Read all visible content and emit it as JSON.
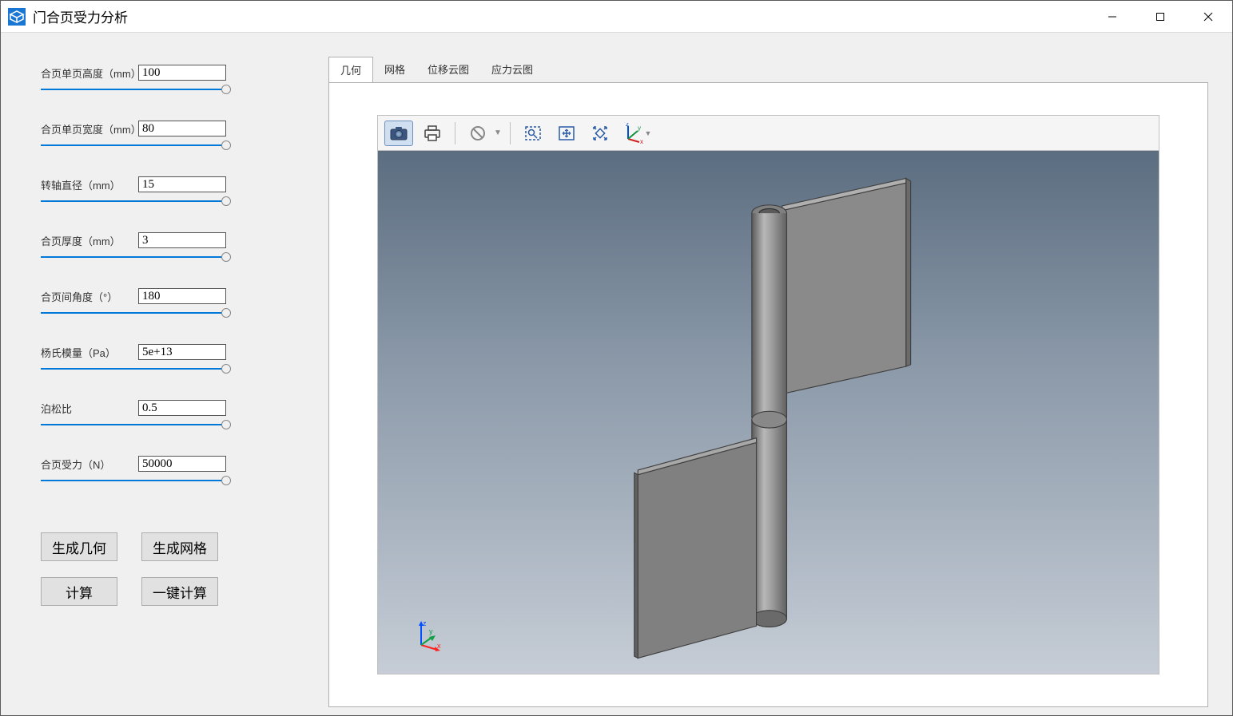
{
  "window": {
    "title": "门合页受力分析"
  },
  "params": [
    {
      "label": "合页单页高度（mm）",
      "value": "100"
    },
    {
      "label": "合页单页宽度（mm）",
      "value": "80"
    },
    {
      "label": "转轴直径（mm）",
      "value": "15"
    },
    {
      "label": "合页厚度（mm）",
      "value": "3"
    },
    {
      "label": "合页间角度（°）",
      "value": "180"
    },
    {
      "label": "杨氏模量（Pa）",
      "value": "5e+13"
    },
    {
      "label": "泊松比",
      "value": "0.5"
    },
    {
      "label": "合页受力（N）",
      "value": "50000"
    }
  ],
  "buttons": {
    "gen_geom": "生成几何",
    "gen_mesh": "生成网格",
    "calc": "计算",
    "one_click": "一键计算"
  },
  "tabs": {
    "geom": "几何",
    "mesh": "网格",
    "disp": "位移云图",
    "stress": "应力云图"
  },
  "toolbar_icons": {
    "camera": "camera-icon",
    "print": "print-icon",
    "clear": "no-symbol-icon",
    "zoom_area": "zoom-area-icon",
    "fit": "fit-view-icon",
    "zoom_extents": "zoom-extents-icon",
    "axes": "axes-icon"
  },
  "axis_labels": {
    "x": "x",
    "y": "y",
    "z": "z"
  }
}
